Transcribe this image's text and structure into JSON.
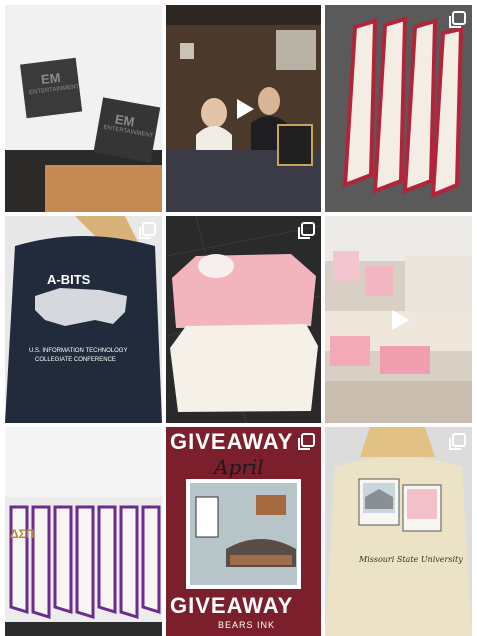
{
  "colors": {
    "giveaway_maroon": "#7c1f2c",
    "stole_red": "#b3243a",
    "stole_purple": "#6a2c91",
    "gold": "#b08a3a"
  },
  "posts": [
    {
      "id": "coasters",
      "type": "image",
      "icon": "",
      "texts": {
        "brand1": "EM",
        "brand1_sub": "ENTERTAINMENT",
        "brand2": "EM",
        "brand2_sub": "ENTERTAINMENT"
      }
    },
    {
      "id": "booth",
      "type": "video",
      "icon": "play-icon"
    },
    {
      "id": "red-stoles",
      "type": "carousel",
      "icon": "carousel-icon"
    },
    {
      "id": "abits-shirt",
      "type": "carousel",
      "icon": "carousel-icon",
      "texts": {
        "title": "A-BITS",
        "line1": "U.S. INFORMATION TECHNOLOGY",
        "line2": "COLLEGIATE CONFERENCE"
      }
    },
    {
      "id": "sweatshirts",
      "type": "carousel",
      "icon": "carousel-icon"
    },
    {
      "id": "merch-table",
      "type": "video",
      "icon": "play-icon"
    },
    {
      "id": "dsp-stoles",
      "type": "image",
      "icon": "",
      "texts": {
        "letters": "ΔΣΠ"
      }
    },
    {
      "id": "giveaway",
      "type": "carousel",
      "icon": "carousel-icon",
      "texts": {
        "headline": "GIVEAWAY",
        "month": "April",
        "footer": "BEARS INK"
      }
    },
    {
      "id": "msu-sweatshirt",
      "type": "carousel",
      "icon": "carousel-icon",
      "texts": {
        "script": "Missouri State University"
      }
    }
  ]
}
